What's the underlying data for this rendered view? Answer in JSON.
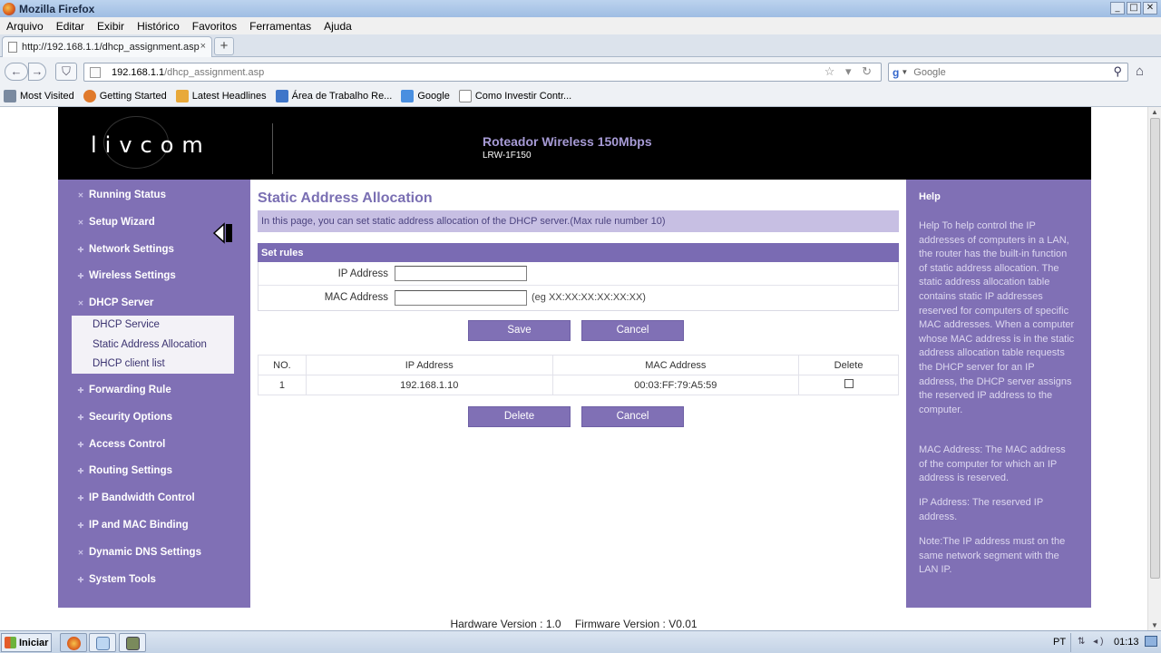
{
  "window": {
    "title": "Mozilla Firefox",
    "controls": [
      "_",
      "□",
      "✕"
    ]
  },
  "menu": [
    "Arquivo",
    "Editar",
    "Exibir",
    "Histórico",
    "Favoritos",
    "Ferramentas",
    "Ajuda"
  ],
  "tab": {
    "label": "http://192.168.1.1/dhcp_assignment.asp",
    "close": "×",
    "new_tab": "+"
  },
  "nav": {
    "back": "←",
    "forward": "→",
    "url_host": "192.168.1.1",
    "url_path": "/dhcp_assignment.asp",
    "url_icons": "☆ ▾ ↻",
    "search_placeholder": "Google",
    "search_icon": "⚲",
    "home": "⌂"
  },
  "bookmarks": [
    {
      "label": "Most Visited",
      "color": "#7a8aa0"
    },
    {
      "label": "Getting Started",
      "color": "#e07a2c"
    },
    {
      "label": "Latest Headlines",
      "color": "#e8a93a"
    },
    {
      "label": "Área de Trabalho Re...",
      "color": "#3f76c9"
    },
    {
      "label": "Google",
      "color": "#4a8fe0"
    },
    {
      "label": "Como Investir  Contr...",
      "color": "#ffffff"
    }
  ],
  "banner": {
    "logo": "livcom",
    "product_name": "Roteador Wireless 150Mbps",
    "product_model": "LRW-1F150"
  },
  "sidebar": {
    "items": [
      {
        "label": "Running Status",
        "bullet": "✕"
      },
      {
        "label": "Setup Wizard",
        "bullet": "✕"
      },
      {
        "label": "Network Settings",
        "bullet": "✚"
      },
      {
        "label": "Wireless Settings",
        "bullet": "✚"
      },
      {
        "label": "DHCP Server",
        "bullet": "✕"
      },
      {
        "label": "Forwarding Rule",
        "bullet": "✚"
      },
      {
        "label": "Security Options",
        "bullet": "✚"
      },
      {
        "label": "Access Control",
        "bullet": "✚"
      },
      {
        "label": "Routing Settings",
        "bullet": "✚"
      },
      {
        "label": "IP Bandwidth Control",
        "bullet": "✚"
      },
      {
        "label": "IP and MAC Binding",
        "bullet": "✚"
      },
      {
        "label": "Dynamic DNS Settings",
        "bullet": "✕"
      },
      {
        "label": "System Tools",
        "bullet": "✚"
      }
    ],
    "submenu": [
      "DHCP Service",
      "Static Address Allocation",
      "DHCP client list"
    ]
  },
  "main": {
    "title": "Static Address Allocation",
    "info": "In this page, you can set static address allocation of the DHCP server.(Max rule number 10)",
    "rules_header": "Set rules",
    "ip_label": "IP Address",
    "ip_value": "",
    "mac_label": "MAC Address",
    "mac_value": "",
    "mac_hint": "(eg XX:XX:XX:XX:XX:XX)",
    "save": "Save",
    "cancel": "Cancel",
    "table": {
      "headers": [
        "NO.",
        "IP Address",
        "MAC Address",
        "Delete"
      ],
      "rows": [
        {
          "no": "1",
          "ip": "192.168.1.10",
          "mac": "00:03:FF:79:A5:59",
          "delete_checked": false
        }
      ]
    },
    "delete": "Delete",
    "cancel2": "Cancel"
  },
  "help": {
    "title": "Help",
    "paragraphs": [
      "Help To help control the IP addresses of computers in a LAN, the router has the built-in function of static address allocation. The static address allocation table contains static IP addresses reserved for computers of specific MAC addresses. When a computer whose MAC address is in the static address allocation table requests the DHCP server for an IP address, the DHCP server assigns the reserved IP address to the computer.",
      "MAC Address: The MAC address of the computer for which an IP address is reserved.",
      "IP Address: The reserved IP address.",
      "Note:The IP address must on the same network segment with the LAN IP."
    ]
  },
  "footer": {
    "hardware": "Hardware Version : 1.0",
    "firmware": "Firmware Version : V0.01"
  },
  "taskbar": {
    "start": "Iniciar",
    "lang": "PT",
    "tray_icons": "⇅ ◂)",
    "time": "01:13"
  }
}
